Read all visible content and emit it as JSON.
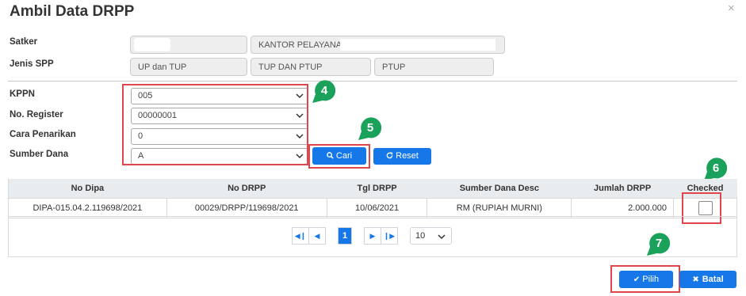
{
  "dialog": {
    "title": "Ambil Data DRPP",
    "close_glyph": "×"
  },
  "satker": {
    "label": "Satker",
    "code": "",
    "name": "KANTOR PELAYANAN P"
  },
  "jenis_spp": {
    "label": "Jenis SPP",
    "values": [
      "UP dan TUP",
      "TUP DAN PTUP",
      "PTUP"
    ]
  },
  "filters": {
    "kppn": {
      "label": "KPPN",
      "value": "005"
    },
    "no_register": {
      "label": "No. Register",
      "value": "00000001"
    },
    "cara_penarikan": {
      "label": "Cara Penarikan",
      "value": "0"
    },
    "sumber_dana": {
      "label": "Sumber Dana",
      "value": "A"
    }
  },
  "buttons": {
    "cari": "Cari",
    "reset": "Reset",
    "pilih": "Pilih",
    "batal": "Batal"
  },
  "table": {
    "headers": [
      "No Dipa",
      "No DRPP",
      "Tgl DRPP",
      "Sumber Dana Desc",
      "Jumlah DRPP",
      "Checked"
    ],
    "rows": [
      {
        "no_dipa": "DIPA-015.04.2.119698/2021",
        "no_drpp": "00029/DRPP/119698/2021",
        "tgl_drpp": "10/06/2021",
        "sumber_dana_desc": "RM (RUPIAH MURNI)",
        "jumlah_drpp": "2.000.000",
        "checked": false
      }
    ]
  },
  "pagination": {
    "current_page": "1",
    "page_size": "10"
  },
  "annotations": {
    "step_4": "4",
    "step_5": "5",
    "step_6": "6",
    "step_7": "7",
    "highlight_color": "#e0464b",
    "badge_color": "#1aa25b"
  },
  "colors": {
    "primary": "#1677e8",
    "header_bg": "#e9ecef"
  }
}
